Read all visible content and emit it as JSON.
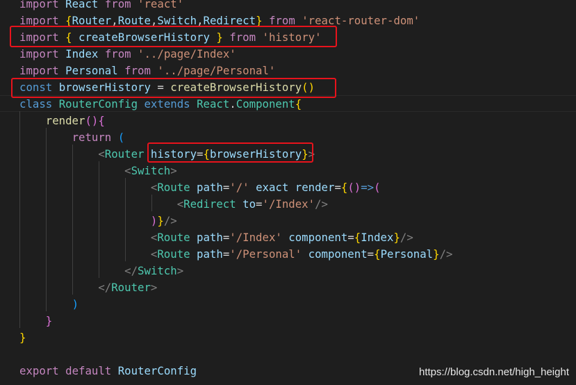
{
  "colors": {
    "background": "#1e1e1e",
    "highlight_box": "#e8131c",
    "keyword": "#c586c0",
    "string": "#ce9178",
    "variable": "#9cdcfe",
    "function": "#dcdcaa",
    "type": "#4ec9b0",
    "storage": "#569cd6",
    "tag_bracket": "#808080"
  },
  "lines": [
    [
      [
        "import",
        "kw"
      ],
      [
        " ",
        "pu"
      ],
      [
        "React",
        "va"
      ],
      [
        " ",
        "pu"
      ],
      [
        "from",
        "kw"
      ],
      [
        " ",
        "pu"
      ],
      [
        "'react'",
        "st"
      ]
    ],
    [
      [
        "import",
        "kw"
      ],
      [
        " ",
        "pu"
      ],
      [
        "{",
        "yb"
      ],
      [
        "Router",
        "va"
      ],
      [
        ",",
        "pu"
      ],
      [
        "Route",
        "va"
      ],
      [
        ",",
        "pu"
      ],
      [
        "Switch",
        "va"
      ],
      [
        ",",
        "pu"
      ],
      [
        "Redirect",
        "va"
      ],
      [
        "}",
        "yb"
      ],
      [
        " ",
        "pu"
      ],
      [
        "from",
        "kw"
      ],
      [
        " ",
        "pu"
      ],
      [
        "'react-router-dom'",
        "st"
      ]
    ],
    [
      [
        "import",
        "kw"
      ],
      [
        " ",
        "pu"
      ],
      [
        "{",
        "yb"
      ],
      [
        " ",
        "pu"
      ],
      [
        "createBrowserHistory",
        "va"
      ],
      [
        " ",
        "pu"
      ],
      [
        "}",
        "yb"
      ],
      [
        " ",
        "pu"
      ],
      [
        "from",
        "kw"
      ],
      [
        " ",
        "pu"
      ],
      [
        "'history'",
        "st"
      ]
    ],
    [
      [
        "import",
        "kw"
      ],
      [
        " ",
        "pu"
      ],
      [
        "Index",
        "va"
      ],
      [
        " ",
        "pu"
      ],
      [
        "from",
        "kw"
      ],
      [
        " ",
        "pu"
      ],
      [
        "'../page/Index'",
        "st"
      ]
    ],
    [
      [
        "import",
        "kw"
      ],
      [
        " ",
        "pu"
      ],
      [
        "Personal",
        "va"
      ],
      [
        " ",
        "pu"
      ],
      [
        "from",
        "kw"
      ],
      [
        " ",
        "pu"
      ],
      [
        "'../page/Personal'",
        "st"
      ]
    ],
    [
      [
        "const",
        "bl"
      ],
      [
        " ",
        "pu"
      ],
      [
        "browserHistory",
        "va"
      ],
      [
        " = ",
        "pu"
      ],
      [
        "createBrowserHistory",
        "fn"
      ],
      [
        "()",
        "yb"
      ]
    ],
    [
      [
        "class",
        "bl"
      ],
      [
        " ",
        "pu"
      ],
      [
        "RouterConfig",
        "ty"
      ],
      [
        " ",
        "pu"
      ],
      [
        "extends",
        "bl"
      ],
      [
        " ",
        "pu"
      ],
      [
        "React",
        "ty"
      ],
      [
        ".",
        "pu"
      ],
      [
        "Component",
        "ty"
      ],
      [
        "{",
        "yb"
      ]
    ],
    [
      [
        "    ",
        "pu"
      ],
      [
        "render",
        "fn"
      ],
      [
        "()",
        "pb"
      ],
      [
        "{",
        "pb"
      ]
    ],
    [
      [
        "        ",
        "pu"
      ],
      [
        "return",
        "kw"
      ],
      [
        " ",
        "pu"
      ],
      [
        "(",
        "bb"
      ]
    ],
    [
      [
        "            ",
        "pu"
      ],
      [
        "<",
        "tg"
      ],
      [
        "Router",
        "ty"
      ],
      [
        " ",
        "pu"
      ],
      [
        "history",
        "va"
      ],
      [
        "=",
        "pu"
      ],
      [
        "{",
        "yb"
      ],
      [
        "browserHistory",
        "va"
      ],
      [
        "}",
        "yb"
      ],
      [
        ">",
        "tg"
      ]
    ],
    [
      [
        "                ",
        "pu"
      ],
      [
        "<",
        "tg"
      ],
      [
        "Switch",
        "ty"
      ],
      [
        ">",
        "tg"
      ]
    ],
    [
      [
        "                    ",
        "pu"
      ],
      [
        "<",
        "tg"
      ],
      [
        "Route",
        "ty"
      ],
      [
        " ",
        "pu"
      ],
      [
        "path",
        "va"
      ],
      [
        "=",
        "pu"
      ],
      [
        "'/'",
        "st"
      ],
      [
        " ",
        "pu"
      ],
      [
        "exact",
        "va"
      ],
      [
        " ",
        "pu"
      ],
      [
        "render",
        "va"
      ],
      [
        "=",
        "pu"
      ],
      [
        "{",
        "yb"
      ],
      [
        "()",
        "pb"
      ],
      [
        "=>",
        "bl"
      ],
      [
        "(",
        "pb"
      ]
    ],
    [
      [
        "                        ",
        "pu"
      ],
      [
        "<",
        "tg"
      ],
      [
        "Redirect",
        "ty"
      ],
      [
        " ",
        "pu"
      ],
      [
        "to",
        "va"
      ],
      [
        "=",
        "pu"
      ],
      [
        "'/Index'",
        "st"
      ],
      [
        "/>",
        "tg"
      ]
    ],
    [
      [
        "                    ",
        "pu"
      ],
      [
        ")",
        "pb"
      ],
      [
        "}",
        "yb"
      ],
      [
        "/>",
        "tg"
      ]
    ],
    [
      [
        "                    ",
        "pu"
      ],
      [
        "<",
        "tg"
      ],
      [
        "Route",
        "ty"
      ],
      [
        " ",
        "pu"
      ],
      [
        "path",
        "va"
      ],
      [
        "=",
        "pu"
      ],
      [
        "'/Index'",
        "st"
      ],
      [
        " ",
        "pu"
      ],
      [
        "component",
        "va"
      ],
      [
        "=",
        "pu"
      ],
      [
        "{",
        "yb"
      ],
      [
        "Index",
        "va"
      ],
      [
        "}",
        "yb"
      ],
      [
        "/>",
        "tg"
      ]
    ],
    [
      [
        "                    ",
        "pu"
      ],
      [
        "<",
        "tg"
      ],
      [
        "Route",
        "ty"
      ],
      [
        " ",
        "pu"
      ],
      [
        "path",
        "va"
      ],
      [
        "=",
        "pu"
      ],
      [
        "'/Personal'",
        "st"
      ],
      [
        " ",
        "pu"
      ],
      [
        "component",
        "va"
      ],
      [
        "=",
        "pu"
      ],
      [
        "{",
        "yb"
      ],
      [
        "Personal",
        "va"
      ],
      [
        "}",
        "yb"
      ],
      [
        "/>",
        "tg"
      ]
    ],
    [
      [
        "                ",
        "pu"
      ],
      [
        "</",
        "tg"
      ],
      [
        "Switch",
        "ty"
      ],
      [
        ">",
        "tg"
      ]
    ],
    [
      [
        "            ",
        "pu"
      ],
      [
        "</",
        "tg"
      ],
      [
        "Router",
        "ty"
      ],
      [
        ">",
        "tg"
      ]
    ],
    [
      [
        "        ",
        "pu"
      ],
      [
        ")",
        "bb"
      ]
    ],
    [
      [
        "    ",
        "pu"
      ],
      [
        "}",
        "pb"
      ]
    ],
    [
      [
        "}",
        "yb"
      ]
    ],
    [],
    [
      [
        "export",
        "kw"
      ],
      [
        " ",
        "pu"
      ],
      [
        "default",
        "kw"
      ],
      [
        " ",
        "pu"
      ],
      [
        "RouterConfig",
        "va"
      ]
    ]
  ],
  "watermark": "https://blog.csdn.net/high_height"
}
